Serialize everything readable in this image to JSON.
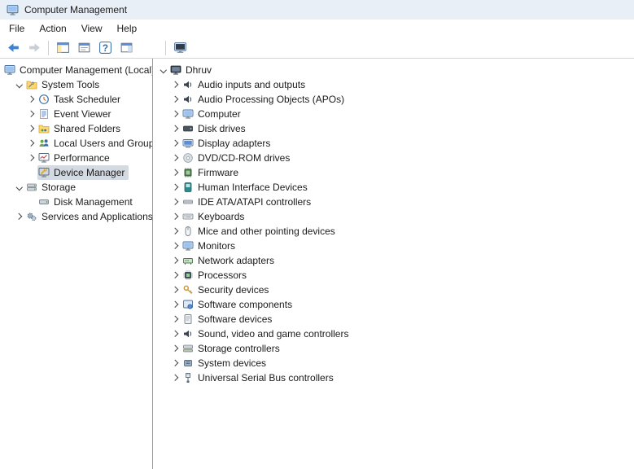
{
  "colors": {
    "titlebar_background": "#e9eff7",
    "selection_background": "#d4dae1"
  },
  "window": {
    "title": "Computer Management"
  },
  "menu_bar": {
    "items": [
      {
        "name": "menu-file",
        "label": "File"
      },
      {
        "name": "menu-action",
        "label": "Action"
      },
      {
        "name": "menu-view",
        "label": "View"
      },
      {
        "name": "menu-help",
        "label": "Help"
      }
    ]
  },
  "toolbar": {
    "buttons": [
      {
        "name": "back-button",
        "icon": "back-arrow-icon",
        "enabled": true
      },
      {
        "name": "forward-button",
        "icon": "forward-arrow-icon",
        "enabled": false
      },
      {
        "type": "separator"
      },
      {
        "name": "show-hide-console-tree-button",
        "icon": "console-tree-icon",
        "enabled": true
      },
      {
        "name": "properties-button",
        "icon": "properties-window-icon",
        "enabled": true
      },
      {
        "name": "help-button",
        "icon": "help-icon",
        "enabled": true
      },
      {
        "name": "action-pane-button",
        "icon": "action-pane-icon",
        "enabled": true
      },
      {
        "type": "separator",
        "gap": 34
      },
      {
        "name": "scan-hardware-button",
        "icon": "scan-hardware-icon",
        "enabled": true
      }
    ]
  },
  "console_tree": {
    "items": [
      {
        "label": "Computer Management (Local)",
        "depth": 0,
        "chevron": "none",
        "gutter": false,
        "icon": "computer-management-icon"
      },
      {
        "label": "System Tools",
        "depth": 1,
        "chevron": "down",
        "icon": "system-tools-icon"
      },
      {
        "label": "Task Scheduler",
        "depth": 2,
        "chevron": "right",
        "icon": "task-scheduler-icon"
      },
      {
        "label": "Event Viewer",
        "depth": 2,
        "chevron": "right",
        "icon": "event-viewer-icon"
      },
      {
        "label": "Shared Folders",
        "depth": 2,
        "chevron": "right",
        "icon": "shared-folders-icon"
      },
      {
        "label": "Local Users and Groups",
        "depth": 2,
        "chevron": "right",
        "icon": "local-users-groups-icon"
      },
      {
        "label": "Performance",
        "depth": 2,
        "chevron": "right",
        "icon": "performance-icon"
      },
      {
        "label": "Device Manager",
        "depth": 2,
        "chevron": "none",
        "icon": "device-manager-icon",
        "selected": true
      },
      {
        "label": "Storage",
        "depth": 1,
        "chevron": "down",
        "icon": "storage-icon"
      },
      {
        "label": "Disk Management",
        "depth": 2,
        "chevron": "none",
        "icon": "disk-management-icon"
      },
      {
        "label": "Services and Applications",
        "depth": 1,
        "chevron": "right",
        "icon": "services-applications-icon"
      }
    ]
  },
  "device_tree": {
    "items": [
      {
        "label": "Dhruv",
        "depth": 0,
        "chevron": "down",
        "icon": "computer-name-icon"
      },
      {
        "label": "Audio inputs and outputs",
        "depth": 1,
        "chevron": "right",
        "icon": "audio-inputs-icon"
      },
      {
        "label": "Audio Processing Objects (APOs)",
        "depth": 1,
        "chevron": "right",
        "icon": "audio-processing-icon"
      },
      {
        "label": "Computer",
        "depth": 1,
        "chevron": "right",
        "icon": "computer-icon"
      },
      {
        "label": "Disk drives",
        "depth": 1,
        "chevron": "right",
        "icon": "disk-drives-icon"
      },
      {
        "label": "Display adapters",
        "depth": 1,
        "chevron": "right",
        "icon": "display-adapters-icon"
      },
      {
        "label": "DVD/CD-ROM drives",
        "depth": 1,
        "chevron": "right",
        "icon": "dvd-drives-icon"
      },
      {
        "label": "Firmware",
        "depth": 1,
        "chevron": "right",
        "icon": "firmware-icon"
      },
      {
        "label": "Human Interface Devices",
        "depth": 1,
        "chevron": "right",
        "icon": "hid-icon"
      },
      {
        "label": "IDE ATA/ATAPI controllers",
        "depth": 1,
        "chevron": "right",
        "icon": "ide-controllers-icon"
      },
      {
        "label": "Keyboards",
        "depth": 1,
        "chevron": "right",
        "icon": "keyboard-icon"
      },
      {
        "label": "Mice and other pointing devices",
        "depth": 1,
        "chevron": "right",
        "icon": "mouse-icon"
      },
      {
        "label": "Monitors",
        "depth": 1,
        "chevron": "right",
        "icon": "monitor-icon"
      },
      {
        "label": "Network adapters",
        "depth": 1,
        "chevron": "right",
        "icon": "network-adapters-icon"
      },
      {
        "label": "Processors",
        "depth": 1,
        "chevron": "right",
        "icon": "processors-icon"
      },
      {
        "label": "Security devices",
        "depth": 1,
        "chevron": "right",
        "icon": "security-devices-icon"
      },
      {
        "label": "Software components",
        "depth": 1,
        "chevron": "right",
        "icon": "software-components-icon"
      },
      {
        "label": "Software devices",
        "depth": 1,
        "chevron": "right",
        "icon": "software-devices-icon"
      },
      {
        "label": "Sound, video and game controllers",
        "depth": 1,
        "chevron": "right",
        "icon": "sound-controllers-icon"
      },
      {
        "label": "Storage controllers",
        "depth": 1,
        "chevron": "right",
        "icon": "storage-controllers-icon"
      },
      {
        "label": "System devices",
        "depth": 1,
        "chevron": "right",
        "icon": "system-devices-icon"
      },
      {
        "label": "Universal Serial Bus controllers",
        "depth": 1,
        "chevron": "right",
        "icon": "usb-controllers-icon"
      }
    ]
  }
}
